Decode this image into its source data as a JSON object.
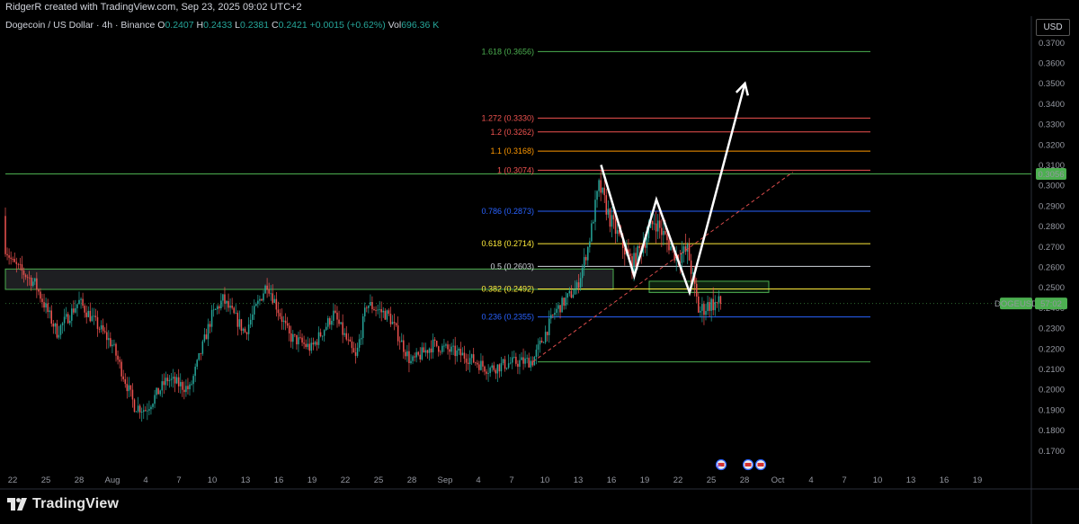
{
  "header": {
    "author": "RidgerR created with TradingView.com, Sep 23, 2025 09:02 UTC+2",
    "symbol": "Dogecoin / US Dollar · 4h · Binance",
    "ohlc": [
      {
        "label": "O",
        "value": "0.2407"
      },
      {
        "label": "H",
        "value": "0.2433"
      },
      {
        "label": "L",
        "value": "0.2381"
      },
      {
        "label": "C",
        "value": "0.2421"
      },
      {
        "label": "",
        "value": "+0.0015 (+0.62%)"
      },
      {
        "label": "Vol",
        "value": "696.36 K"
      }
    ],
    "currency": "USD"
  },
  "brand": {
    "name": "TradingView"
  },
  "colors": {
    "up": "#26a69a",
    "down": "#ef5350",
    "zone_border": "#4caf50",
    "white_path": "#ffffff",
    "trend_dash": "#d84b4b",
    "price_tag": "#4caf50"
  },
  "chart_data": {
    "type": "candlestick",
    "symbol": "DOGEUSD",
    "interval": "4h",
    "ylim": [
      0.16,
      0.375
    ],
    "y_ticks": [
      "0.1700",
      "0.1800",
      "0.1900",
      "0.2000",
      "0.2100",
      "0.2200",
      "0.2300",
      "0.2400",
      "0.2500",
      "0.2600",
      "0.2700",
      "0.2800",
      "0.2900",
      "0.3000",
      "0.3100",
      "0.3200",
      "0.3300",
      "0.3400",
      "0.3500",
      "0.3600",
      "0.3700"
    ],
    "x_ticks": [
      "22",
      "25",
      "28",
      "Aug",
      "4",
      "7",
      "10",
      "13",
      "16",
      "19",
      "22",
      "25",
      "28",
      "Sep",
      "4",
      "7",
      "10",
      "13",
      "16",
      "19",
      "22",
      "25",
      "28",
      "Oct",
      "4",
      "7",
      "10",
      "13",
      "16",
      "19"
    ],
    "current_price_tag": {
      "label": "DOGEUSD",
      "countdown": "57:02",
      "value": 0.2421
    },
    "level_tag": {
      "label": "0.3056",
      "value": 0.3056
    },
    "fib_levels": [
      {
        "label": "1.618 (0.3656)",
        "value": 0.3656,
        "color": "#4caf50"
      },
      {
        "label": "1.272 (0.3330)",
        "value": 0.333,
        "color": "#ef5350"
      },
      {
        "label": "1.2 (0.3262)",
        "value": 0.3262,
        "color": "#ef5350"
      },
      {
        "label": "1.1 (0.3168)",
        "value": 0.3168,
        "color": "#ff9800"
      },
      {
        "label": "1 (0.3074)",
        "value": 0.3074,
        "color": "#ef5350"
      },
      {
        "label": "0.786 (0.2873)",
        "value": 0.2873,
        "color": "#2962ff"
      },
      {
        "label": "0.618 (0.2714)",
        "value": 0.2714,
        "color": "#ffeb3b"
      },
      {
        "label": "0.5 (0.2603)",
        "value": 0.2603,
        "color": "#d1d4dc"
      },
      {
        "label": "0.382 (0.2492)",
        "value": 0.2492,
        "color": "#ffeb3b"
      },
      {
        "label": "0.236 (0.2355)",
        "value": 0.2355,
        "color": "#2962ff"
      }
    ],
    "fib_base": {
      "value": 0.2135,
      "color": "#4caf50"
    },
    "horizontal_level": {
      "value": 0.3056,
      "color": "#4caf50"
    },
    "zones": [
      {
        "name": "supply-zone",
        "y_top": 0.259,
        "y_bottom": 0.249,
        "x_start": "Jul 20",
        "x_end": "Sep 12"
      },
      {
        "name": "retest-zone",
        "y_top": 0.253,
        "y_bottom": 0.2475,
        "x_start": "Sep 17",
        "x_end": "Sep 24"
      }
    ],
    "trendline": {
      "from": {
        "date": "Sep 7",
        "value": 0.2135
      },
      "to": {
        "date": "Sep 30",
        "value": 0.3065
      },
      "style": "dashed"
    },
    "projection_path": [
      {
        "date": "Sep 13",
        "value": 0.31
      },
      {
        "date": "Sep 16",
        "value": 0.2555
      },
      {
        "date": "Sep 18",
        "value": 0.293
      },
      {
        "date": "Sep 21",
        "value": 0.2475
      },
      {
        "date": "Sep 26",
        "value": 0.35
      }
    ],
    "price_anchors": [
      {
        "date": "Jul 20",
        "value": 0.285
      },
      {
        "date": "Jul 22",
        "value": 0.262
      },
      {
        "date": "Jul 24",
        "value": 0.252
      },
      {
        "date": "Jul 26",
        "value": 0.228
      },
      {
        "date": "Jul 28",
        "value": 0.243
      },
      {
        "date": "Jul 31",
        "value": 0.222
      },
      {
        "date": "Aug 2",
        "value": 0.192
      },
      {
        "date": "Aug 3",
        "value": 0.19
      },
      {
        "date": "Aug 5",
        "value": 0.205
      },
      {
        "date": "Aug 7",
        "value": 0.2
      },
      {
        "date": "Aug 9",
        "value": 0.236
      },
      {
        "date": "Aug 10",
        "value": 0.244
      },
      {
        "date": "Aug 12",
        "value": 0.228
      },
      {
        "date": "Aug 14",
        "value": 0.252
      },
      {
        "date": "Aug 16",
        "value": 0.226
      },
      {
        "date": "Aug 18",
        "value": 0.22
      },
      {
        "date": "Aug 20",
        "value": 0.237
      },
      {
        "date": "Aug 22",
        "value": 0.215
      },
      {
        "date": "Aug 23",
        "value": 0.242
      },
      {
        "date": "Aug 25",
        "value": 0.236
      },
      {
        "date": "Aug 27",
        "value": 0.213
      },
      {
        "date": "Aug 29",
        "value": 0.222
      },
      {
        "date": "Sep 1",
        "value": 0.216
      },
      {
        "date": "Sep 3",
        "value": 0.21
      },
      {
        "date": "Sep 5",
        "value": 0.213
      },
      {
        "date": "Sep 7",
        "value": 0.214
      },
      {
        "date": "Sep 9",
        "value": 0.238
      },
      {
        "date": "Sep 11",
        "value": 0.25
      },
      {
        "date": "Sep 12",
        "value": 0.27
      },
      {
        "date": "Sep 13",
        "value": 0.3
      },
      {
        "date": "Sep 14",
        "value": 0.283
      },
      {
        "date": "Sep 16",
        "value": 0.261
      },
      {
        "date": "Sep 18",
        "value": 0.283
      },
      {
        "date": "Sep 20",
        "value": 0.265
      },
      {
        "date": "Sep 21",
        "value": 0.268
      },
      {
        "date": "Sep 22",
        "value": 0.238
      },
      {
        "date": "Sep 23",
        "value": 0.242
      }
    ]
  }
}
